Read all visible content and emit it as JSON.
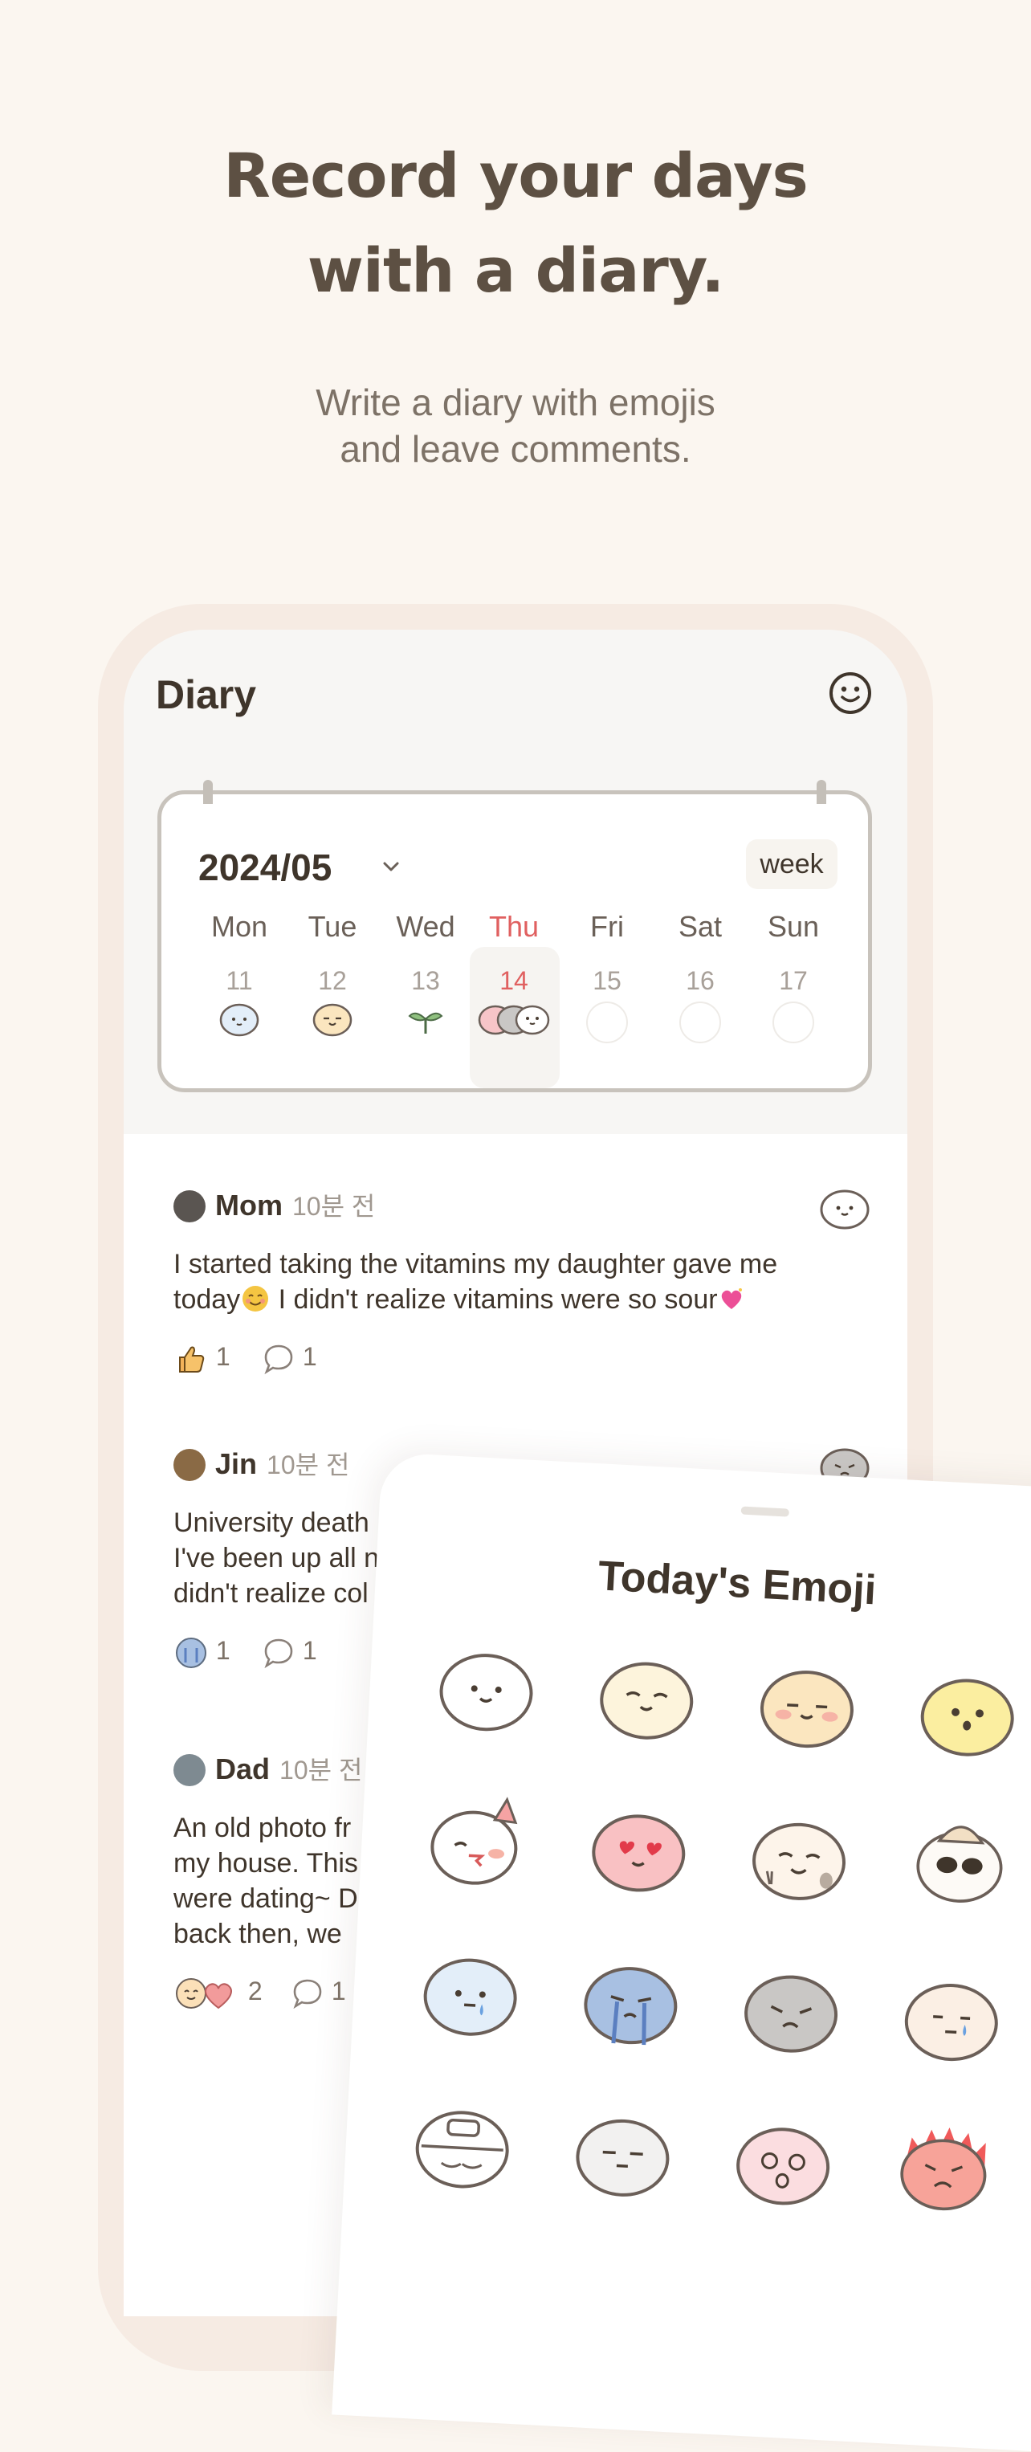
{
  "promo": {
    "headline_line1": "Record your days",
    "headline_line2": "with a diary.",
    "sub_line1": "Write a diary with emojis",
    "sub_line2": "and leave comments."
  },
  "app": {
    "title": "Diary",
    "profile_icon": "smiley-face-icon"
  },
  "calendar": {
    "month": "2024/05",
    "view_button": "week",
    "days": [
      {
        "name": "Mon",
        "num": "11",
        "mood": "blue-calm"
      },
      {
        "name": "Tue",
        "num": "12",
        "mood": "yellow-content"
      },
      {
        "name": "Wed",
        "num": "13",
        "mood": "sprout"
      },
      {
        "name": "Thu",
        "num": "14",
        "mood": "multi",
        "today": true
      },
      {
        "name": "Fri",
        "num": "15",
        "mood": "none"
      },
      {
        "name": "Sat",
        "num": "16",
        "mood": "none"
      },
      {
        "name": "Sun",
        "num": "17",
        "mood": "none"
      }
    ]
  },
  "feed": {
    "posts": [
      {
        "author": "Mom",
        "ago": "10분 전",
        "line1": "I started taking the vitamins my daughter gave me",
        "line2a": "today",
        "line2b": " I didn't realize vitamins were so sour",
        "reaction_count": "1",
        "comment_count": "1"
      },
      {
        "author": "Jin",
        "ago": "10분 전",
        "line1": "University death",
        "line2": "I've been up all n",
        "line3": "didn't realize col",
        "reaction_count": "1",
        "comment_count": "1"
      },
      {
        "author": "Dad",
        "ago": "10분 전",
        "line1": "An old photo fr",
        "line2": "my house. This",
        "line3": "were dating~ D",
        "line4": "back then, we",
        "reaction_count": "2",
        "comment_count": "1"
      }
    ]
  },
  "emoji_sheet": {
    "title": "Today's Emoji"
  },
  "colors": {
    "background": "#fbf6f0",
    "headline": "#5d5043",
    "today_accent": "#e06060",
    "emoji_outline": "#6b5f58"
  }
}
